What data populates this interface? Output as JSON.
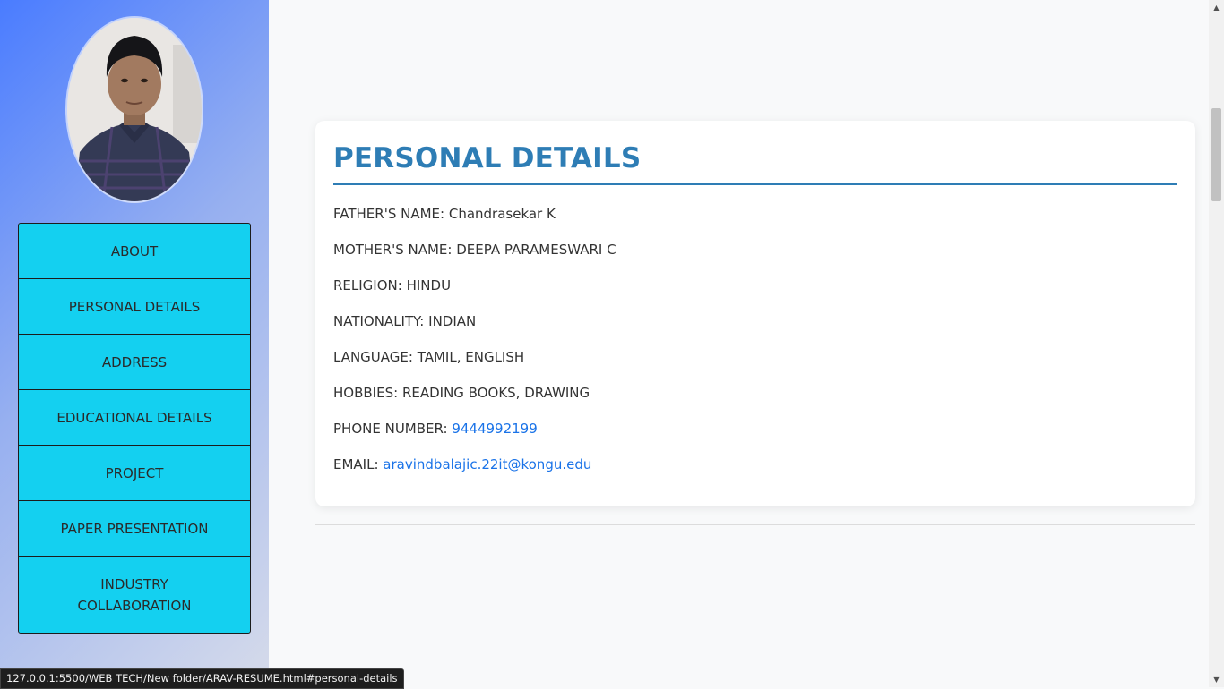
{
  "sidebar": {
    "avatar_alt": "profile photo",
    "items": [
      {
        "label": "ABOUT"
      },
      {
        "label": "PERSONAL DETAILS"
      },
      {
        "label": "ADDRESS"
      },
      {
        "label": "EDUCATIONAL DETAILS"
      },
      {
        "label": "PROJECT"
      },
      {
        "label": "PAPER PRESENTATION"
      },
      {
        "label": "INDUSTRY\nCOLLABORATION"
      }
    ]
  },
  "personal": {
    "title": "PERSONAL DETAILS",
    "father_label": "FATHER'S NAME:",
    "father_value": "Chandrasekar K",
    "mother_label": "MOTHER'S NAME:",
    "mother_value": "DEEPA PARAMESWARI C",
    "religion_label": "RELIGION:",
    "religion_value": "HINDU",
    "nationality_label": "NATIONALITY:",
    "nationality_value": "INDIAN",
    "language_label": "LANGUAGE:",
    "language_value": "TAMIL, ENGLISH",
    "hobbies_label": "HOBBIES:",
    "hobbies_value": "READING BOOKS, DRAWING",
    "phone_label": "PHONE NUMBER:",
    "phone_value": "9444992199",
    "email_label": "EMAIL:",
    "email_value": "aravindbalajic.22it@kongu.edu"
  },
  "status_bar": {
    "url": "127.0.0.1:5500/WEB TECH/New folder/ARAV-RESUME.html#personal-details"
  },
  "colors": {
    "accent": "#2e7db5",
    "nav_bg": "#14d0f0",
    "link": "#1a73e8"
  }
}
